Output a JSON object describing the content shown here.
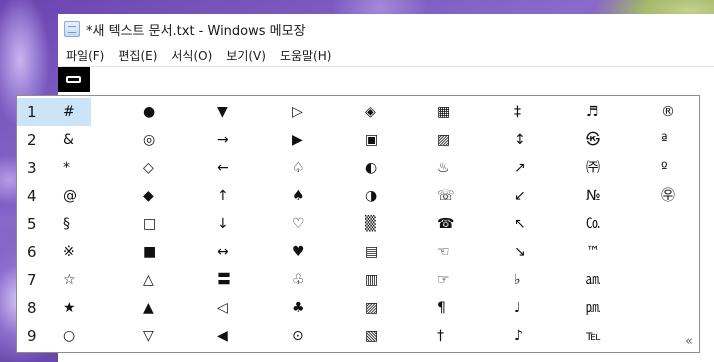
{
  "window": {
    "title": "*새 텍스트 문서.txt - Windows 메모장"
  },
  "menu": [
    "파일(F)",
    "편집(E)",
    "서식(O)",
    "보기(V)",
    "도움말(H)"
  ],
  "candidate_window": {
    "selected_row": 1,
    "rows": [
      {
        "num": "1",
        "symbols": [
          "#",
          "●",
          "▼",
          "▷",
          "◈",
          "▦",
          "‡",
          "♬",
          "®"
        ]
      },
      {
        "num": "2",
        "symbols": [
          "&",
          "◎",
          "→",
          "▶",
          "▣",
          "▨",
          "↕",
          "㉿",
          "ª"
        ]
      },
      {
        "num": "3",
        "symbols": [
          "*",
          "◇",
          "←",
          "♤",
          "◐",
          "♨",
          "↗",
          "㈜",
          "º"
        ]
      },
      {
        "num": "4",
        "symbols": [
          "@",
          "◆",
          "↑",
          "♠",
          "◑",
          "☏",
          "↙",
          "№",
          "㉾"
        ]
      },
      {
        "num": "5",
        "symbols": [
          "§",
          "□",
          "↓",
          "♡",
          "▒",
          "☎",
          "↖",
          "㏇",
          ""
        ]
      },
      {
        "num": "6",
        "symbols": [
          "※",
          "■",
          "↔",
          "♥",
          "▤",
          "☜",
          "↘",
          "™",
          ""
        ]
      },
      {
        "num": "7",
        "symbols": [
          "☆",
          "△",
          "〓",
          "♧",
          "▥",
          "☞",
          "♭",
          "㏂",
          ""
        ]
      },
      {
        "num": "8",
        "symbols": [
          "★",
          "▲",
          "◁",
          "♣",
          "▨",
          "¶",
          "♩",
          "㏘",
          ""
        ]
      },
      {
        "num": "9",
        "symbols": [
          "○",
          "▽",
          "◀",
          "⊙",
          "▧",
          "†",
          "♪",
          "℡",
          ""
        ]
      }
    ],
    "expand_glyph": "«"
  }
}
